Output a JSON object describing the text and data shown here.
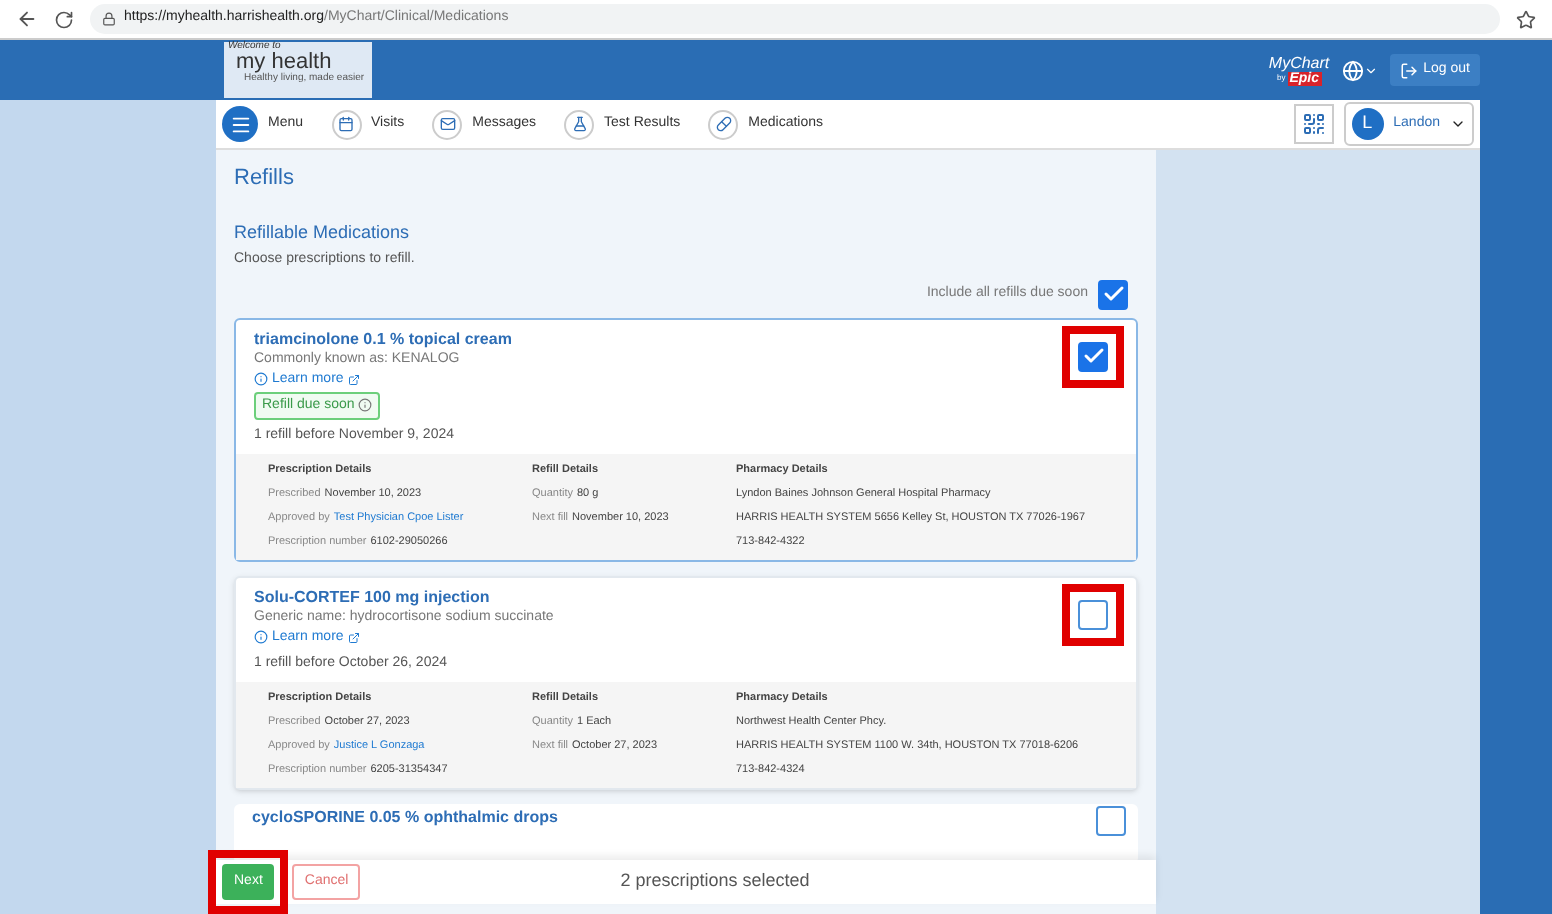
{
  "browser": {
    "url_domain": "https://myhealth.harrishealth.org",
    "url_path": "/MyChart/Clinical/Medications"
  },
  "header": {
    "logo_top": "Welcome to",
    "logo_main": "my health",
    "logo_tag": "Healthy living, made easier",
    "brand_top": "MyChart",
    "brand_by": "by",
    "brand_epic": "Epic",
    "logout": "Log out"
  },
  "nav": {
    "items": [
      {
        "label": "Menu",
        "kind": "menu"
      },
      {
        "label": "Visits",
        "kind": "visits"
      },
      {
        "label": "Messages",
        "kind": "messages"
      },
      {
        "label": "Test Results",
        "kind": "tests"
      },
      {
        "label": "Medications",
        "kind": "meds"
      }
    ],
    "user_initial": "L",
    "user_name": "Landon"
  },
  "page": {
    "title": "Refills",
    "section": "Refillable Medications",
    "instructions": "Choose prescriptions to refill.",
    "include_all": {
      "label": "Include all refills due soon",
      "checked": true
    }
  },
  "medications": [
    {
      "name": "triamcinolone 0.1 % topical cream",
      "alt_name": "Commonly known as: KENALOG",
      "learn_more": "Learn more",
      "badge": "Refill due soon",
      "refills": "1 refill before November 9, 2024",
      "checked": true,
      "highlighted": true,
      "details": {
        "prescription_heading": "Prescription Details",
        "prescribed_label": "Prescribed",
        "prescribed": "November 10, 2023",
        "approved_label": "Approved by",
        "approved_by": "Test Physician Cpoe Lister",
        "number_label": "Prescription number",
        "number": "6102-29050266",
        "refill_heading": "Refill Details",
        "quantity_label": "Quantity",
        "quantity": "80 g",
        "next_label": "Next fill",
        "next_fill": "November 10, 2023",
        "pharmacy_heading": "Pharmacy Details",
        "pharmacy": "Lyndon Baines Johnson General Hospital Pharmacy",
        "address": "HARRIS HEALTH SYSTEM 5656 Kelley St, HOUSTON TX 77026-1967",
        "phone": "713-842-4322"
      }
    },
    {
      "name": "Solu-CORTEF 100 mg injection",
      "alt_name": "Generic name: hydrocortisone sodium succinate",
      "learn_more": "Learn more",
      "refills": "1 refill before October 26, 2024",
      "checked": false,
      "highlighted": true,
      "details": {
        "prescription_heading": "Prescription Details",
        "prescribed_label": "Prescribed",
        "prescribed": "October 27, 2023",
        "approved_label": "Approved by",
        "approved_by": "Justice L Gonzaga",
        "number_label": "Prescription number",
        "number": "6205-31354347",
        "refill_heading": "Refill Details",
        "quantity_label": "Quantity",
        "quantity": "1 Each",
        "next_label": "Next fill",
        "next_fill": "October 27, 2023",
        "pharmacy_heading": "Pharmacy Details",
        "pharmacy": "Northwest Health Center Phcy.",
        "address": "HARRIS HEALTH SYSTEM 1100 W. 34th, HOUSTON TX 77018-6206",
        "phone": "713-842-4324"
      }
    },
    {
      "name": "cycloSPORINE 0.05 % ophthalmic drops",
      "checked": false,
      "highlighted": false
    }
  ],
  "footer": {
    "next": "Next",
    "next_highlighted": true,
    "cancel": "Cancel",
    "status": "2 prescriptions selected"
  }
}
